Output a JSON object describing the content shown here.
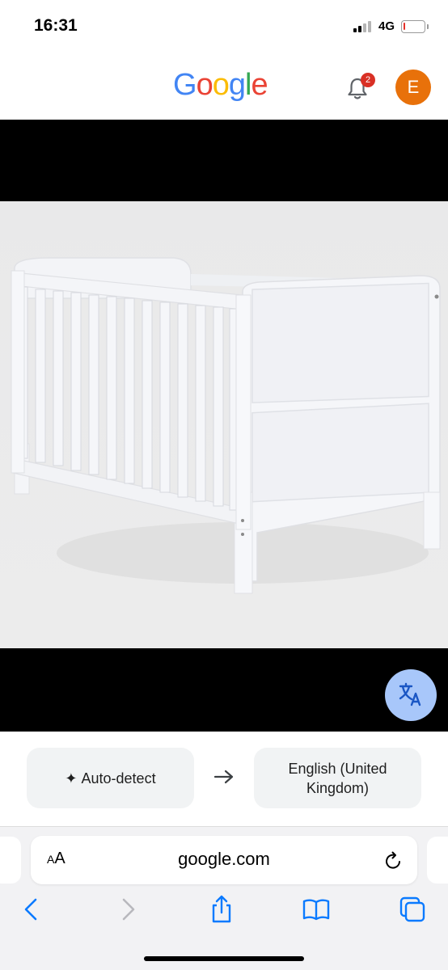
{
  "status_bar": {
    "time": "16:31",
    "network": "4G",
    "battery_level": 0.08,
    "battery_color": "#e5312a"
  },
  "header": {
    "logo_letters": [
      "G",
      "o",
      "o",
      "g",
      "l",
      "e"
    ],
    "logo_colors": [
      "#4285f4",
      "#ea4335",
      "#fbbc05",
      "#4285f4",
      "#34a853",
      "#ea4335"
    ],
    "notification_count": "2",
    "avatar_initial": "E",
    "avatar_color": "#e8710a"
  },
  "viewer": {
    "image_subject": "white-wooden-cot-bed",
    "translate_button_icon": "translate-icon"
  },
  "translate": {
    "source_label": "Auto-detect",
    "source_icon": "sparkle-icon",
    "target_label_line1": "English (United",
    "target_label_line2": "Kingdom)"
  },
  "browser": {
    "text_size_label_small": "A",
    "text_size_label_large": "A",
    "url": "google.com",
    "toolbar_icons": [
      "back-icon",
      "forward-icon",
      "share-icon",
      "bookmarks-icon",
      "tabs-icon"
    ]
  }
}
